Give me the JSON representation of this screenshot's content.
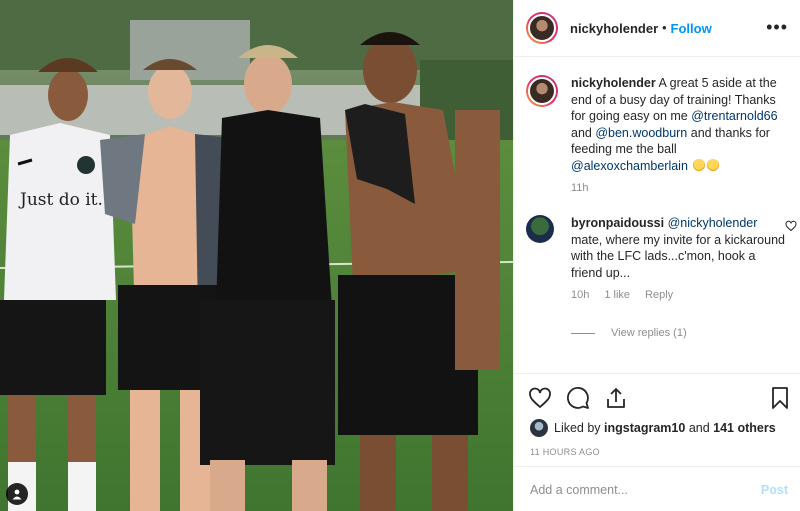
{
  "header": {
    "username": "nickyholender",
    "separator": "•",
    "follow_label": "Follow",
    "more_icon": "more-horizontal-icon"
  },
  "caption": {
    "username": "nickyholender",
    "text_1": "A great 5 aside at the end of a busy day of training! Thanks for going easy on me",
    "mention_1": "@trentarnold66",
    "text_2": "and",
    "mention_2": "@ben.woodburn",
    "text_3": "and thanks for feeding me the ball",
    "mention_3": "@alexoxchamberlain",
    "emojis": "grinning-sweat-emoji x2",
    "age": "11h"
  },
  "comment": {
    "username": "byronpaidoussi",
    "mention": "@nickyholender",
    "text": "mate, where my invite for a kickaround with the LFC lads...c'mon, hook a friend up...",
    "age": "10h",
    "likes": "1 like",
    "reply_label": "Reply",
    "view_replies": "View replies (1)"
  },
  "actions": {
    "icons": [
      "heart-icon",
      "comment-icon",
      "share-icon",
      "bookmark-icon"
    ]
  },
  "likes": {
    "prefix": "Liked by",
    "user": "ingstagram10",
    "joiner": "and",
    "others": "141 others"
  },
  "timestamp": "11 HOURS AGO",
  "add_comment": {
    "placeholder": "Add a comment...",
    "post_label": "Post"
  },
  "photo": {
    "jersey_text": "Just do it.",
    "description_icon": "user-tag-icon"
  },
  "colors": {
    "link": "#00376b",
    "follow": "#0095f6",
    "post_disabled": "#b2dffc",
    "muted": "#8e8e8e",
    "border": "#efefef"
  }
}
